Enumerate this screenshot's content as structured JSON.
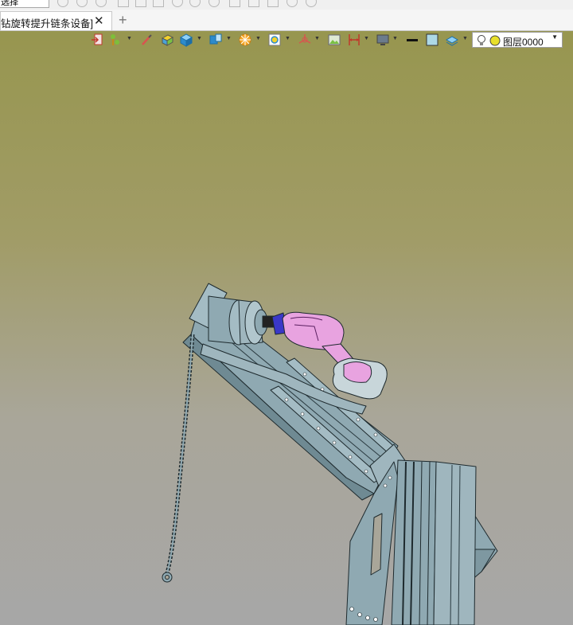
{
  "top_toolbar": {
    "selection_filter": "选择"
  },
  "tabs": [
    {
      "label": "钻旋转提升链条设备]",
      "active": true
    }
  ],
  "tab_controls": {
    "close": "✕",
    "add": "+"
  },
  "view_toolbar": {
    "icons": [
      "exit-sketch-icon",
      "pin-icon",
      "brush-icon",
      "face-color-icon",
      "solid-display-icon",
      "section-view-icon",
      "orientation-icon",
      "zoom-fit-icon",
      "triad-icon",
      "image-icon",
      "dimension-icon",
      "monitor-icon",
      "line-color-icon",
      "fill-color-icon",
      "layers-icon"
    ],
    "layer_selector": {
      "value": "图层0000"
    }
  },
  "colors": {
    "drill_body": "#e8a3e0",
    "model_parts": "#8fa9b2",
    "model_edges": "#1e2a2e",
    "chuck": "#3a38c8"
  }
}
